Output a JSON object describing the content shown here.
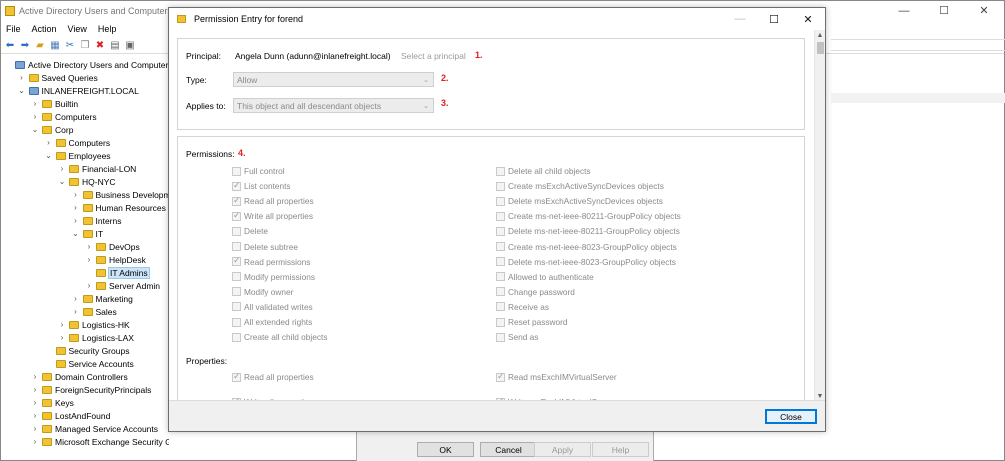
{
  "aduc": {
    "title": "Active Directory Users and Computers",
    "menu": [
      "File",
      "Action",
      "View",
      "Help"
    ],
    "tree": [
      {
        "label": "Active Directory Users and Computers [A",
        "indent": 0,
        "chev": "",
        "icon": "dom"
      },
      {
        "label": "Saved Queries",
        "indent": 1,
        "chev": "›",
        "icon": "folder"
      },
      {
        "label": "INLANEFREIGHT.LOCAL",
        "indent": 1,
        "chev": "⌄",
        "icon": "dom"
      },
      {
        "label": "Builtin",
        "indent": 2,
        "chev": "›",
        "icon": "folder"
      },
      {
        "label": "Computers",
        "indent": 2,
        "chev": "›",
        "icon": "folder"
      },
      {
        "label": "Corp",
        "indent": 2,
        "chev": "⌄",
        "icon": "folder"
      },
      {
        "label": "Computers",
        "indent": 3,
        "chev": "›",
        "icon": "folder"
      },
      {
        "label": "Employees",
        "indent": 3,
        "chev": "⌄",
        "icon": "folder"
      },
      {
        "label": "Financial-LON",
        "indent": 4,
        "chev": "›",
        "icon": "folder"
      },
      {
        "label": "HQ-NYC",
        "indent": 4,
        "chev": "⌄",
        "icon": "folder"
      },
      {
        "label": "Business Developmen",
        "indent": 5,
        "chev": "›",
        "icon": "folder"
      },
      {
        "label": "Human Resources",
        "indent": 5,
        "chev": "›",
        "icon": "folder"
      },
      {
        "label": "Interns",
        "indent": 5,
        "chev": "›",
        "icon": "folder"
      },
      {
        "label": "IT",
        "indent": 5,
        "chev": "⌄",
        "icon": "folder"
      },
      {
        "label": "DevOps",
        "indent": 6,
        "chev": "›",
        "icon": "folder"
      },
      {
        "label": "HelpDesk",
        "indent": 6,
        "chev": "›",
        "icon": "folder"
      },
      {
        "label": "IT Admins",
        "indent": 6,
        "chev": "",
        "icon": "folder",
        "selected": true
      },
      {
        "label": "Server Admin",
        "indent": 6,
        "chev": "›",
        "icon": "folder"
      },
      {
        "label": "Marketing",
        "indent": 5,
        "chev": "›",
        "icon": "folder"
      },
      {
        "label": "Sales",
        "indent": 5,
        "chev": "›",
        "icon": "folder"
      },
      {
        "label": "Logistics-HK",
        "indent": 4,
        "chev": "›",
        "icon": "folder"
      },
      {
        "label": "Logistics-LAX",
        "indent": 4,
        "chev": "›",
        "icon": "folder"
      },
      {
        "label": "Security Groups",
        "indent": 3,
        "chev": "",
        "icon": "folder"
      },
      {
        "label": "Service Accounts",
        "indent": 3,
        "chev": "",
        "icon": "folder"
      },
      {
        "label": "Domain Controllers",
        "indent": 2,
        "chev": "›",
        "icon": "folder"
      },
      {
        "label": "ForeignSecurityPrincipals",
        "indent": 2,
        "chev": "›",
        "icon": "folder"
      },
      {
        "label": "Keys",
        "indent": 2,
        "chev": "›",
        "icon": "folder"
      },
      {
        "label": "LostAndFound",
        "indent": 2,
        "chev": "›",
        "icon": "folder"
      },
      {
        "label": "Managed Service Accounts",
        "indent": 2,
        "chev": "›",
        "icon": "folder"
      },
      {
        "label": "Microsoft Exchange Security Groups",
        "indent": 2,
        "chev": "›",
        "icon": "folder"
      }
    ]
  },
  "security_dialog": {
    "ok_label": "OK",
    "cancel_label": "Cancel",
    "apply_label": "Apply",
    "help_label": "Help"
  },
  "perm_dialog": {
    "title": "Permission Entry for forend",
    "principal_label": "Principal:",
    "principal_name": "Angela Dunn (adunn@inlanefreight.local)",
    "select_principal": "Select a principal",
    "type_label": "Type:",
    "type_value": "Allow",
    "applies_label": "Applies to:",
    "applies_value": "This object and all descendant objects",
    "markers": [
      "1.",
      "2.",
      "3.",
      "4."
    ],
    "permissions_label": "Permissions:",
    "properties_label": "Properties:",
    "close_label": "Close",
    "permissions_left": [
      {
        "label": "Full control",
        "checked": false
      },
      {
        "label": "List contents",
        "checked": true
      },
      {
        "label": "Read all properties",
        "checked": true
      },
      {
        "label": "Write all properties",
        "checked": true
      },
      {
        "label": "Delete",
        "checked": false
      },
      {
        "label": "Delete subtree",
        "checked": false
      },
      {
        "label": "Read permissions",
        "checked": true
      },
      {
        "label": "Modify permissions",
        "checked": false
      },
      {
        "label": "Modify owner",
        "checked": false
      },
      {
        "label": "All validated writes",
        "checked": false
      },
      {
        "label": "All extended rights",
        "checked": false
      },
      {
        "label": "Create all child objects",
        "checked": false
      }
    ],
    "permissions_right": [
      {
        "label": "Delete all child objects",
        "checked": false
      },
      {
        "label": "Create msExchActiveSyncDevices objects",
        "checked": false
      },
      {
        "label": "Delete msExchActiveSyncDevices objects",
        "checked": false
      },
      {
        "label": "Create ms-net-ieee-80211-GroupPolicy objects",
        "checked": false
      },
      {
        "label": "Delete ms-net-ieee-80211-GroupPolicy objects",
        "checked": false
      },
      {
        "label": "Create ms-net-ieee-8023-GroupPolicy objects",
        "checked": false
      },
      {
        "label": "Delete ms-net-ieee-8023-GroupPolicy objects",
        "checked": false
      },
      {
        "label": "Allowed to authenticate",
        "checked": false
      },
      {
        "label": "Change password",
        "checked": false
      },
      {
        "label": "Receive as",
        "checked": false
      },
      {
        "label": "Reset password",
        "checked": false
      },
      {
        "label": "Send as",
        "checked": false
      }
    ],
    "properties_left": [
      {
        "label": "Read all properties",
        "checked": true
      },
      {
        "label": "Write all properties",
        "checked": true
      }
    ],
    "properties_right": [
      {
        "label": "Read msExchIMVirtualServer",
        "checked": true
      },
      {
        "label": "Write msExchIMVirtualServer",
        "checked": true
      }
    ]
  }
}
